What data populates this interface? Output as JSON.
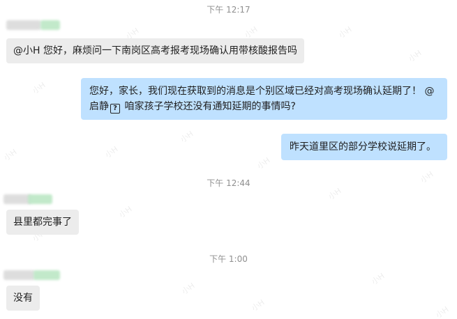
{
  "watermark": "小H",
  "messages": [
    {
      "kind": "timestamp",
      "text": "下午 12:17"
    },
    {
      "kind": "incoming",
      "text": "@小H 您好，麻烦问一下南岗区高考报考现场确认用带核酸报告吗"
    },
    {
      "kind": "outgoing",
      "line1": "您好，家长，我们现在获取到的消息是个别区域已经对高考现场确认延期了！ @",
      "line2_pre": "启静",
      "line2_post": " 咱家孩子学校还没有通知延期的事情吗?"
    },
    {
      "kind": "outgoing",
      "text": "昨天道里区的部分学校说延期了。"
    },
    {
      "kind": "timestamp",
      "text": "下午 12:44"
    },
    {
      "kind": "incoming",
      "text": "县里都完事了"
    },
    {
      "kind": "timestamp",
      "text": "下午 1:00"
    },
    {
      "kind": "incoming",
      "text": "没有"
    }
  ],
  "colors": {
    "incoming_bubble": "#ececec",
    "outgoing_bubble": "#bfe1ff",
    "timestamp": "#8f8f8f",
    "blurred_name_gray": "#dcdcdc",
    "blurred_name_green": "#bfe8c8"
  },
  "icons": {
    "unknown_glyph": "question-box-icon"
  }
}
